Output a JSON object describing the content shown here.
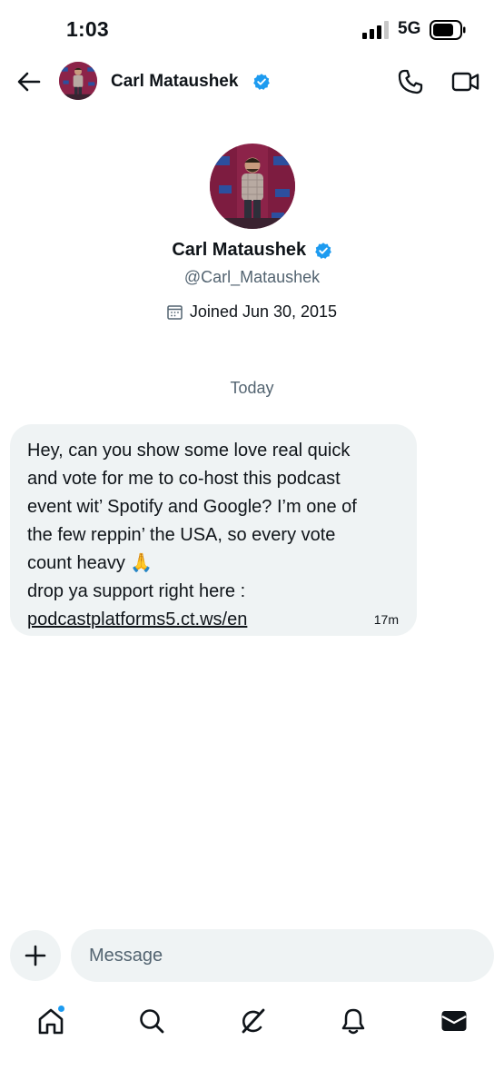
{
  "status_bar": {
    "time": "1:03",
    "network": "5G",
    "icons": [
      "signal-bars-icon",
      "battery-icon"
    ]
  },
  "header": {
    "name": "Carl Mataushek",
    "verified": true,
    "icons": [
      "back-arrow-icon",
      "phone-icon",
      "video-camera-icon"
    ]
  },
  "profile": {
    "name": "Carl Mataushek",
    "handle": "@Carl_Mataushek",
    "joined": "Joined Jun 30, 2015"
  },
  "conversation": {
    "day_label": "Today",
    "messages": [
      {
        "lines": [
          "Hey, can you show some love real quick",
          "and vote for me to co-host this podcast",
          "event wit’ Spotify and Google?  I’m one of",
          "the few reppin’ the USA, so every vote",
          "count heavy 🙏",
          "drop ya support right here :"
        ],
        "link": "podcastplatforms5.ct.ws/en",
        "time": "17m"
      }
    ]
  },
  "composer": {
    "placeholder": "Message"
  },
  "bottom_nav": {
    "items": [
      "home-icon",
      "search-icon",
      "grok-icon",
      "notifications-icon",
      "messages-icon"
    ],
    "home_has_notification": true
  },
  "colors": {
    "accent": "#1d9bf0",
    "bubble": "#eff3f4",
    "secondary_text": "#536471",
    "text": "#0f1419"
  }
}
